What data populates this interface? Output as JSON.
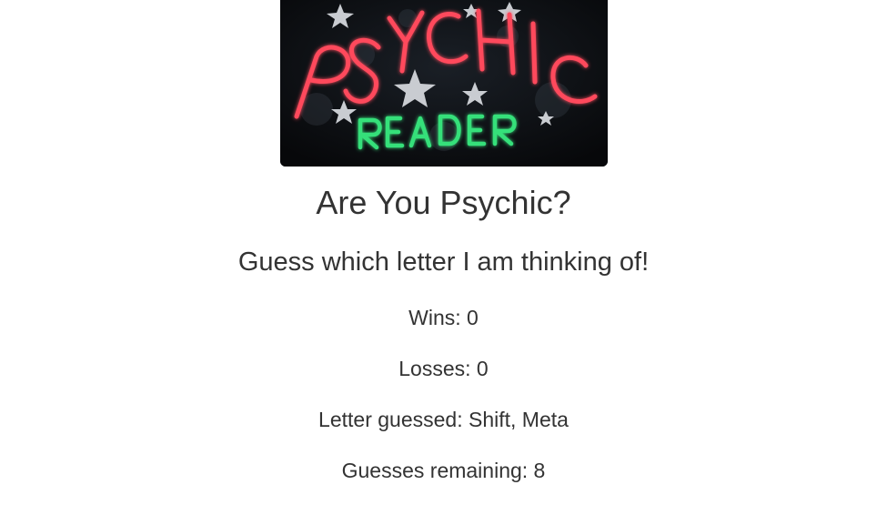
{
  "banner": {
    "line1": "PSYCHIC",
    "line2": "READER",
    "colors": {
      "background": "#0b0d10",
      "neon_red": "#ff4a5c",
      "neon_green": "#36e07a",
      "silver": "#c9ccd1"
    }
  },
  "header": {
    "title": "Are You Psychic?",
    "subtitle": "Guess which letter I am thinking of!"
  },
  "stats": {
    "wins": "Wins: 0",
    "losses": "Losses: 0",
    "letters_guessed": "Letter guessed: Shift, Meta",
    "guesses_remaining": "Guesses remaining: 8"
  }
}
